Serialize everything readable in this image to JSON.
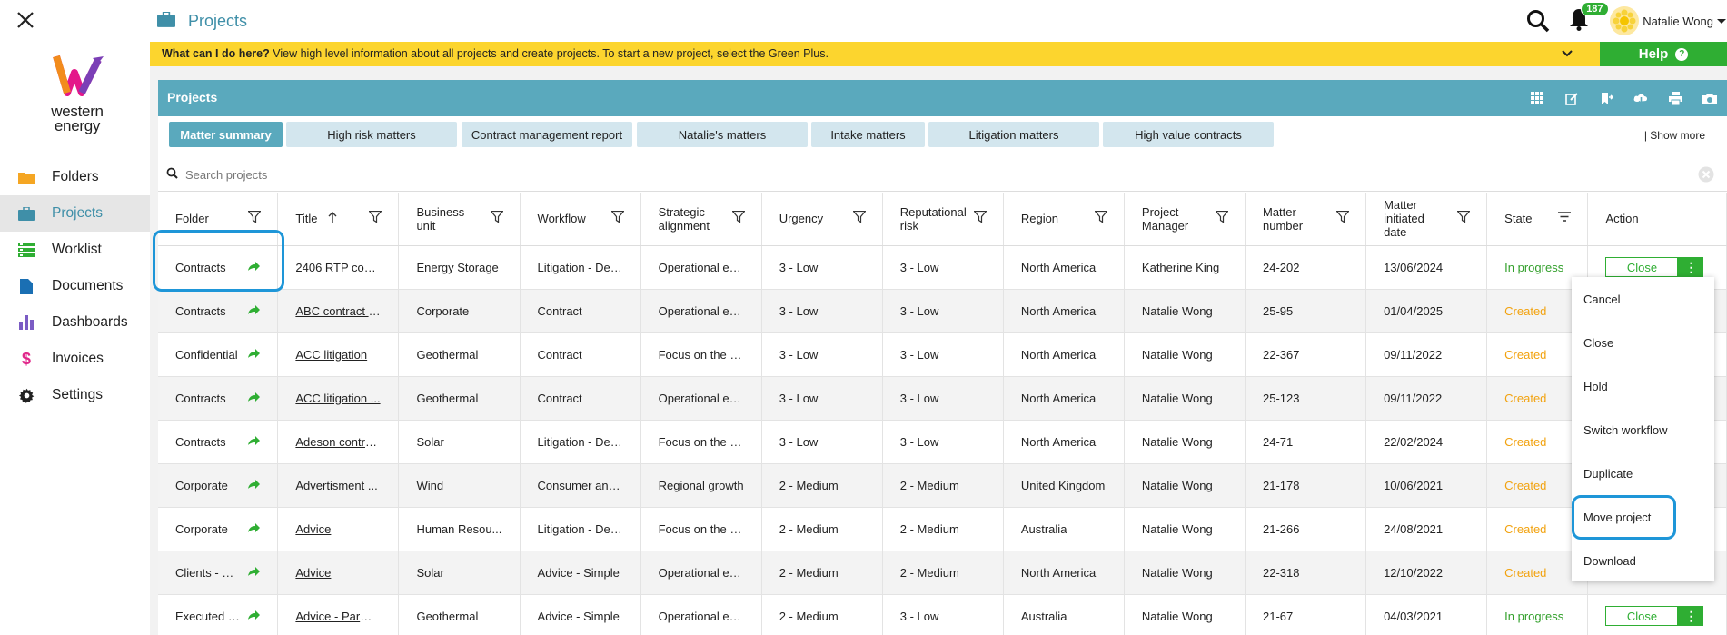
{
  "app": {
    "brand": "western energy",
    "page_title": "Projects"
  },
  "sidebar": {
    "items": [
      {
        "label": "Folders",
        "icon": "folder-icon",
        "color": "#f5a623"
      },
      {
        "label": "Projects",
        "icon": "briefcase-icon",
        "color": "#3f8fa8"
      },
      {
        "label": "Worklist",
        "icon": "worklist-icon",
        "color": "#2fae33"
      },
      {
        "label": "Documents",
        "icon": "document-icon",
        "color": "#1a6fb3"
      },
      {
        "label": "Dashboards",
        "icon": "bar-chart-icon",
        "color": "#7b5cc4"
      },
      {
        "label": "Invoices",
        "icon": "dollar-icon",
        "color": "#e0278a"
      },
      {
        "label": "Settings",
        "icon": "gear-icon",
        "color": "#222"
      }
    ]
  },
  "topbar": {
    "notifications_count": "187",
    "user_name": "Natalie Wong"
  },
  "helpbar": {
    "question": "What can I do here?",
    "text": "View high level information about all projects and create projects. To start a new project, select the Green Plus.",
    "help_label": "Help"
  },
  "panel": {
    "title": "Projects"
  },
  "tabs": [
    "Matter summary",
    "High risk matters",
    "Contract management report",
    "Natalie's matters",
    "Intake matters",
    "Litigation matters",
    "High value contracts"
  ],
  "show_more": "| Show more",
  "search": {
    "placeholder": "Search projects"
  },
  "columns": [
    "Folder",
    "Title",
    "Business unit",
    "Workflow",
    "Strategic alignment",
    "Urgency",
    "Reputational risk",
    "Region",
    "Project Manager",
    "Matter number",
    "Matter initiated date",
    "State",
    "Action"
  ],
  "rows": [
    {
      "folder": "Contracts",
      "title": "2406 RTP cont...",
      "unit": "Energy Storage",
      "workflow": "Litigation - Def...",
      "strategic": "Operational ex...",
      "urgency": "3 - Low",
      "risk": "3 - Low",
      "region": "North America",
      "manager": "Katherine King",
      "number": "24-202",
      "date": "13/06/2024",
      "state": "In progress",
      "action": "Close"
    },
    {
      "folder": "Contracts",
      "title": "ABC contract 2...",
      "unit": "Corporate",
      "workflow": "Contract",
      "strategic": "Operational ex...",
      "urgency": "3 - Low",
      "risk": "3 - Low",
      "region": "North America",
      "manager": "Natalie Wong",
      "number": "25-95",
      "date": "01/04/2025",
      "state": "Created",
      "action": ""
    },
    {
      "folder": "Confidential",
      "title": "ACC litigation",
      "unit": "Geothermal",
      "workflow": "Contract",
      "strategic": "Focus on the c...",
      "urgency": "3 - Low",
      "risk": "3 - Low",
      "region": "North America",
      "manager": "Natalie Wong",
      "number": "22-367",
      "date": "09/11/2022",
      "state": "Created",
      "action": ""
    },
    {
      "folder": "Contracts",
      "title": "ACC litigation ...",
      "unit": "Geothermal",
      "workflow": "Contract",
      "strategic": "Operational ex...",
      "urgency": "3 - Low",
      "risk": "3 - Low",
      "region": "North America",
      "manager": "Natalie Wong",
      "number": "25-123",
      "date": "09/11/2022",
      "state": "Created",
      "action": ""
    },
    {
      "folder": "Contracts",
      "title": "Adeson contra...",
      "unit": "Solar",
      "workflow": "Litigation - Def...",
      "strategic": "Focus on the c...",
      "urgency": "3 - Low",
      "risk": "3 - Low",
      "region": "North America",
      "manager": "Natalie Wong",
      "number": "24-71",
      "date": "22/02/2024",
      "state": "Created",
      "action": ""
    },
    {
      "folder": "Corporate",
      "title": "Advertisment ...",
      "unit": "Wind",
      "workflow": "Consumer and...",
      "strategic": "Regional growth",
      "urgency": "2 - Medium",
      "risk": "2 - Medium",
      "region": "United Kingdom",
      "manager": "Natalie Wong",
      "number": "21-178",
      "date": "10/06/2021",
      "state": "Created",
      "action": ""
    },
    {
      "folder": "Corporate",
      "title": "Advice",
      "unit": "Human Resou...",
      "workflow": "Litigation - Def...",
      "strategic": "Focus on the c...",
      "urgency": "2 - Medium",
      "risk": "2 - Medium",
      "region": "Australia",
      "manager": "Natalie Wong",
      "number": "21-266",
      "date": "24/08/2021",
      "state": "Created",
      "action": ""
    },
    {
      "folder": "Clients - No...",
      "title": "Advice",
      "unit": "Solar",
      "workflow": "Advice - Simple",
      "strategic": "Operational ex...",
      "urgency": "2 - Medium",
      "risk": "2 - Medium",
      "region": "North America",
      "manager": "Natalie Wong",
      "number": "22-318",
      "date": "12/10/2022",
      "state": "Created",
      "action": ""
    },
    {
      "folder": "Executed c...",
      "title": "Advice - Parma...",
      "unit": "Geothermal",
      "workflow": "Advice - Simple",
      "strategic": "Operational ex...",
      "urgency": "2 - Medium",
      "risk": "3 - Low",
      "region": "Australia",
      "manager": "Natalie Wong",
      "number": "21-67",
      "date": "04/03/2021",
      "state": "In progress",
      "action": "Close"
    }
  ],
  "action_menu": [
    "Cancel",
    "Close",
    "Hold",
    "Switch workflow",
    "Duplicate",
    "Move project",
    "Download"
  ],
  "colors": {
    "accent": "#5aa9bd",
    "green": "#2fae33",
    "yellow": "#fcd52e",
    "created": "#f2a20e",
    "highlight": "#1e96d8"
  }
}
